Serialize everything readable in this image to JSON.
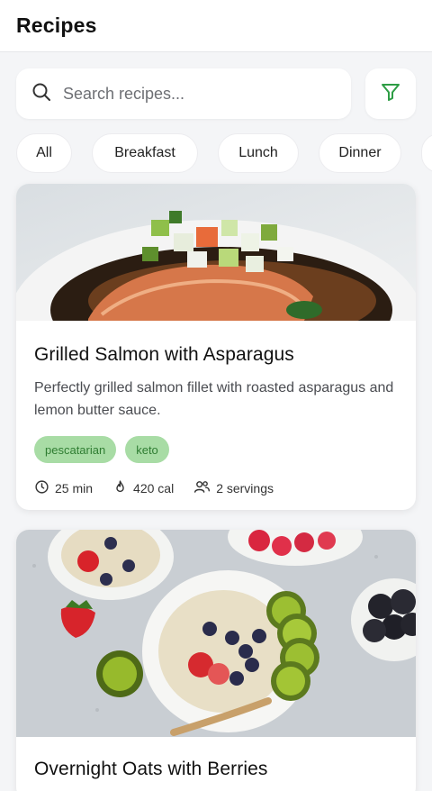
{
  "header": {
    "title": "Recipes"
  },
  "search": {
    "placeholder": "Search recipes..."
  },
  "categories": [
    "All",
    "Breakfast",
    "Lunch",
    "Dinner"
  ],
  "recipes": [
    {
      "title": "Grilled Salmon with Asparagus",
      "description": "Perfectly grilled salmon fillet with roasted asparagus and lemon butter sauce.",
      "tags": [
        "pescatarian",
        "keto"
      ],
      "time": "25 min",
      "calories": "420 cal",
      "servings": "2 servings"
    },
    {
      "title": "Overnight Oats with Berries"
    }
  ],
  "icons": {
    "search": "search-icon",
    "filter": "filter-icon",
    "time": "clock-icon",
    "calories": "flame-icon",
    "servings": "people-icon"
  },
  "colors": {
    "accent": "#2e9d45",
    "tag_bg": "#a8dca5",
    "tag_text": "#2f7d32"
  }
}
